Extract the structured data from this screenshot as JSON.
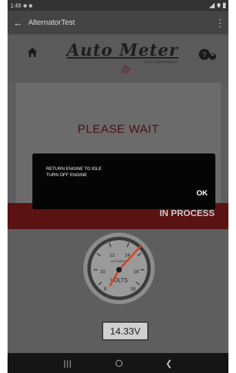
{
  "status_bar": {
    "time": "1:48"
  },
  "app_bar": {
    "title": "AlternatorTest",
    "back_icon": "back-arrow-icon",
    "menu_icon": "overflow-menu-icon"
  },
  "brand": {
    "logo_text": "Auto Meter",
    "logo_subtext": "TEST EQUIPMENT"
  },
  "panel": {
    "message": "PLEASE WAIT",
    "progress_text": "IN PROCESS"
  },
  "gauge": {
    "brand": "AUTO METER",
    "unit": "VOLTS",
    "ticks": [
      "8",
      "10",
      "12",
      "14",
      "16",
      "18"
    ]
  },
  "readout": {
    "value": "14.33V"
  },
  "dialog": {
    "line1": "RETURN ENGINE TO IDLE",
    "line2": "TURN OFF ENGINE",
    "ok_label": "OK"
  },
  "colors": {
    "accent": "#5b1212",
    "dialog_bg": "#050505",
    "needle": "#d4401a"
  }
}
